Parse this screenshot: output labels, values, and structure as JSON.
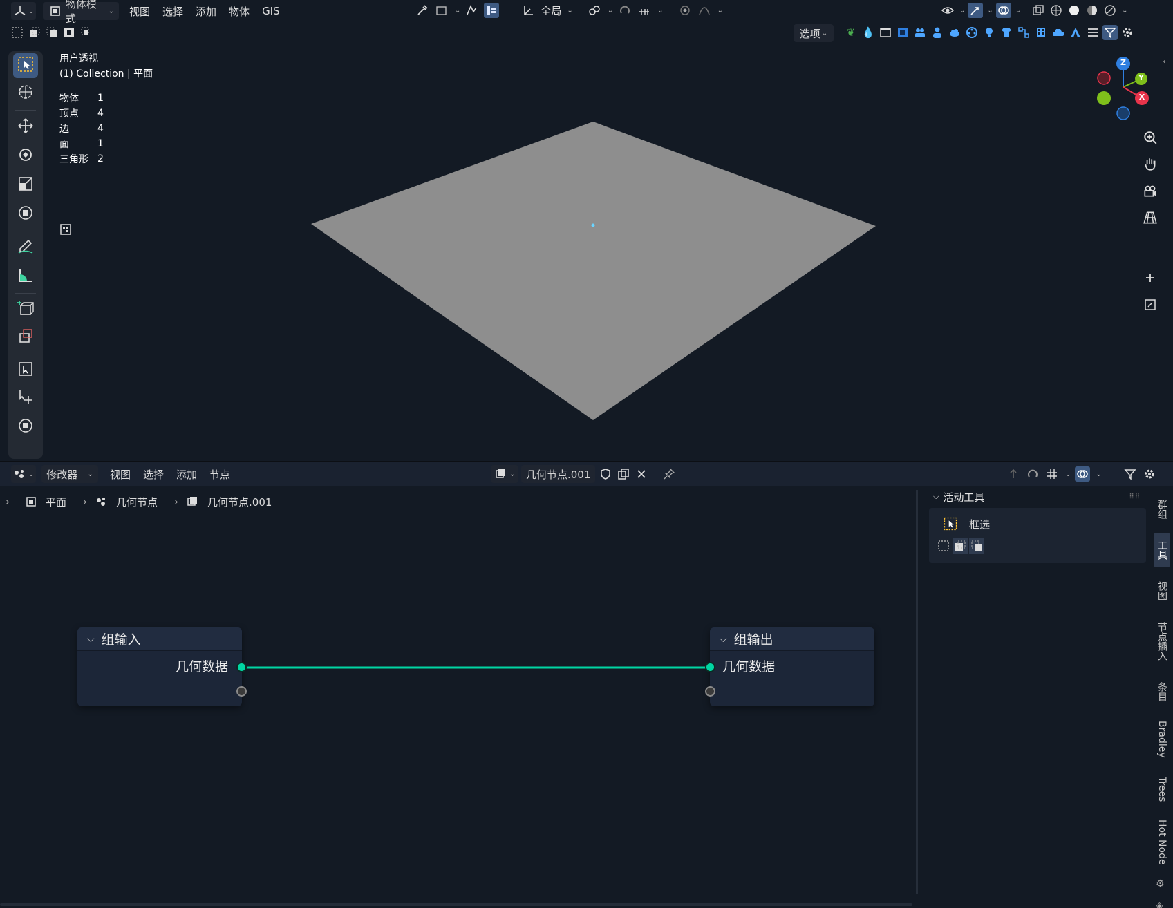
{
  "viewport": {
    "header": {
      "mode_label": "物体模式",
      "menus": [
        "视图",
        "选择",
        "添加",
        "物体",
        "GIS"
      ],
      "transform_orientation": "全局",
      "options_label": "选项"
    },
    "info": {
      "view_name": "用户透视",
      "collection": "(1) Collection | 平面"
    },
    "stats": [
      {
        "label": "物体",
        "value": "1"
      },
      {
        "label": "顶点",
        "value": "4"
      },
      {
        "label": "边",
        "value": "4"
      },
      {
        "label": "面",
        "value": "1"
      },
      {
        "label": "三角形",
        "value": "2"
      }
    ],
    "gizmo": {
      "z": "Z",
      "y": "Y",
      "x": "X"
    },
    "colors": {
      "background": "#131a24",
      "plane": "#8e8e8e",
      "x_axis": "#e8344b",
      "y_axis": "#7fbf1b",
      "z_axis": "#2f7fe0"
    }
  },
  "node_editor": {
    "header": {
      "editor_type_label": "修改器",
      "menus": [
        "视图",
        "选择",
        "添加",
        "节点"
      ],
      "node_tree_name": "几何节点.001"
    },
    "breadcrumb": [
      "平面",
      "几何节点",
      "几何节点.001"
    ],
    "nodes": {
      "group_input": {
        "title": "组输入",
        "socket": "几何数据"
      },
      "group_output": {
        "title": "组输出",
        "socket": "几何数据"
      }
    },
    "link_color": "#00d6a3",
    "sidebar": {
      "panel_title": "活动工具",
      "tool_name": "框选",
      "tabs": [
        "群组",
        "工具",
        "视图",
        "节点插入",
        "条目",
        "Bradley",
        "Trees",
        "Hot Node"
      ]
    }
  }
}
